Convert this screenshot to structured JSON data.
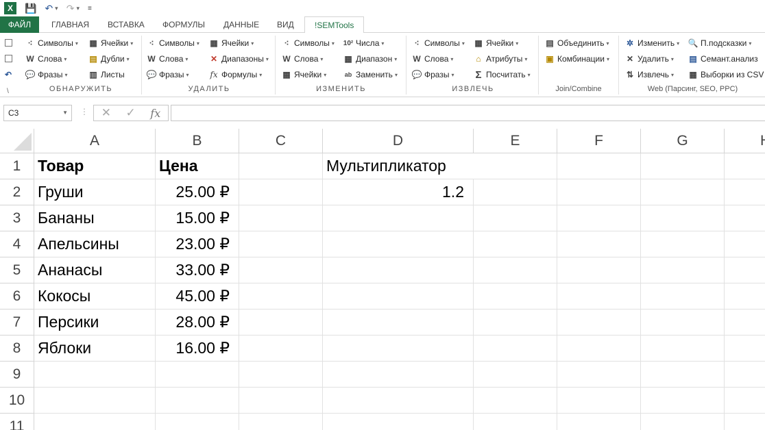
{
  "app": {
    "logo_letter": "X"
  },
  "tabs": {
    "file": "ФАЙЛ",
    "home": "ГЛАВНАЯ",
    "insert": "ВСТАВКА",
    "formulas": "ФОРМУЛЫ",
    "data": "ДАННЫЕ",
    "view": "ВИД",
    "semtools": "!SEMTools"
  },
  "ribbon": {
    "obnaruzhit": {
      "symbols": "Символы",
      "cells": "Ячейки",
      "words": "Слова",
      "dupes": "Дубли",
      "phrases": "Фразы",
      "sheets": "Листы",
      "label": "ОБНАРУЖИТЬ"
    },
    "udalit": {
      "symbols": "Символы",
      "cells": "Ячейки",
      "words": "Слова",
      "ranges": "Диапазоны",
      "phrases": "Фразы",
      "formulas": "Формулы",
      "label": "УДАЛИТЬ"
    },
    "izmenit": {
      "symbols": "Символы",
      "numbers": "Числа",
      "words": "Слова",
      "range": "Диапазон",
      "cells": "Ячейки",
      "replace": "Заменить",
      "label": "ИЗМЕНИТЬ"
    },
    "izvlech": {
      "symbols": "Символы",
      "cells": "Ячейки",
      "words": "Слова",
      "attributes": "Атрибуты",
      "phrases": "Фразы",
      "count": "Посчитать",
      "label": "ИЗВЛЕЧЬ"
    },
    "join": {
      "merge": "Объединить",
      "combos": "Комбинации",
      "label": "Join/Combine"
    },
    "web": {
      "change": "Изменить",
      "suggest": "П.подсказки",
      "delete": "Удалить",
      "semantic": "Семант.анализ",
      "extract": "Извлечь",
      "csv": "Выборки из CSV",
      "label": "Web (Парсинг, SEO, PPC)"
    }
  },
  "formula_bar": {
    "name_box": "C3",
    "fx": "fx",
    "value": ""
  },
  "columns": [
    "A",
    "B",
    "C",
    "D",
    "E",
    "F",
    "G",
    "H"
  ],
  "rows": [
    "1",
    "2",
    "3",
    "4",
    "5",
    "6",
    "7",
    "8",
    "9",
    "10",
    "11"
  ],
  "cells": {
    "A1": "Товар",
    "B1": "Цена",
    "D1": "Мультипликатор",
    "A2": "Груши",
    "B2": "25.00 ₽",
    "D2": "1.2",
    "A3": "Бананы",
    "B3": "15.00 ₽",
    "A4": "Апельсины",
    "B4": "23.00 ₽",
    "A5": "Ананасы",
    "B5": "33.00 ₽",
    "A6": "Кокосы",
    "B6": "45.00 ₽",
    "A7": "Персики",
    "B7": "28.00 ₽",
    "A8": "Яблоки",
    "B8": "16.00 ₽"
  },
  "colors": {
    "excel_green": "#217346",
    "grid_line": "#e1e1e1",
    "header_border": "#d4d4d4"
  }
}
